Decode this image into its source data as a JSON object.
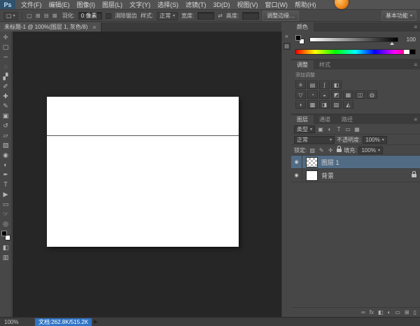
{
  "icons": {
    "caret": "▾",
    "eye": "◉"
  },
  "app": {
    "logo": "Ps",
    "menu_items": [
      "文件(F)",
      "编辑(E)",
      "图像(I)",
      "图层(L)",
      "文字(Y)",
      "选择(S)",
      "滤镜(T)",
      "3D(D)",
      "视图(V)",
      "窗口(W)",
      "帮助(H)"
    ],
    "workspace_button": "基本功能"
  },
  "options_bar": {
    "tool_icon": "▢",
    "mode_icons": [
      "▢",
      "⊞",
      "⊟",
      "⊠"
    ],
    "feather_label": "羽化:",
    "feather_value": "0 像素",
    "antialias_label": "消除锯齿",
    "style_label": "样式:",
    "style_value": "正常",
    "width_label": "宽度:",
    "height_label": "高度:",
    "swap_icon": "⇄",
    "refine_edge_button": "调整边缘…"
  },
  "document_tab": {
    "title": "未标题-1 @ 100%(图层 1, 灰色/8)",
    "close_icon": "×"
  },
  "tools": [
    {
      "name": "移动工具",
      "glyph": "✛"
    },
    {
      "name": "矩形选框工具",
      "glyph": "▢"
    },
    {
      "name": "套索工具",
      "glyph": "∽"
    },
    {
      "name": "快速选择工具",
      "glyph": "◌"
    },
    {
      "name": "裁剪工具",
      "glyph": "▞"
    },
    {
      "name": "吸管工具",
      "glyph": "✐"
    },
    {
      "name": "污点修复画笔工具",
      "glyph": "✚"
    },
    {
      "name": "画笔工具",
      "glyph": "✎"
    },
    {
      "name": "仿制图章工具",
      "glyph": "▣"
    },
    {
      "name": "历史记录画笔工具",
      "glyph": "↺"
    },
    {
      "name": "橡皮擦工具",
      "glyph": "▱"
    },
    {
      "name": "渐变工具",
      "glyph": "▧"
    },
    {
      "name": "模糊工具",
      "glyph": "◉"
    },
    {
      "name": "减淡工具",
      "glyph": "◐"
    },
    {
      "name": "钢笔工具",
      "glyph": "✒"
    },
    {
      "name": "横排文字工具",
      "glyph": "T"
    },
    {
      "name": "路径选择工具",
      "glyph": "▶"
    },
    {
      "name": "矩形工具",
      "glyph": "▭"
    },
    {
      "name": "抓手工具",
      "glyph": "☞"
    },
    {
      "name": "缩放工具",
      "glyph": "◎"
    }
  ],
  "toolbar_extra": {
    "quick_mask_icon": "◧",
    "screen_mode_icon": "▥"
  },
  "dock_strip": {
    "collapse_icon": "«",
    "panel_icon": "▤"
  },
  "color_panel": {
    "tab": "颜色",
    "menu_icon": "≡",
    "slider_value": "100"
  },
  "adjustments_panel": {
    "tab_adjustments": "调整",
    "tab_styles": "样式",
    "menu_icon": "≡",
    "hint": "添加调整",
    "icons_row1": [
      "✳",
      "▤",
      "ʃ",
      "◧"
    ],
    "icons_row2": [
      "▽",
      "◔",
      "◒",
      "◩",
      "▦",
      "◫",
      "◍"
    ],
    "icons_row3": [
      "◖",
      "▩",
      "◨",
      "▧",
      "◭"
    ]
  },
  "layers_panel": {
    "tab_layers": "图层",
    "tab_channels": "通道",
    "tab_paths": "路径",
    "menu_icon": "≡",
    "filter_label": "类型",
    "filter_icons": [
      "▣",
      "◐",
      "T",
      "▭",
      "▦"
    ],
    "blend_mode": "正常",
    "opacity_label": "不透明度:",
    "opacity_value": "100%",
    "lock_label": "锁定:",
    "lock_icons": [
      "▨",
      "✎",
      "✛"
    ],
    "fill_label": "填充:",
    "fill_value": "100%",
    "layers": [
      {
        "name": "图层 1"
      },
      {
        "name": "背景"
      }
    ],
    "bottom_icons": [
      "∞",
      "fx",
      "◧",
      "◐",
      "▭",
      "⊞",
      "▯"
    ]
  },
  "status_bar": {
    "zoom": "100%",
    "doc_info": "文档:262.8K/515.2K",
    "arrow_icon": "▶"
  }
}
